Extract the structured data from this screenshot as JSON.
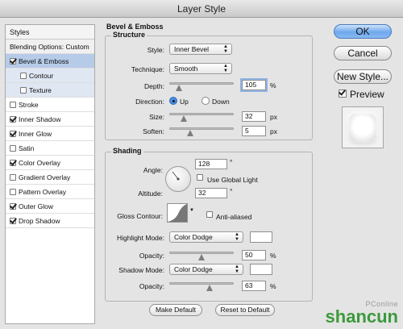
{
  "window": {
    "title": "Layer Style"
  },
  "styles_list": {
    "header": "Styles",
    "blending": "Blending Options: Custom",
    "items": [
      {
        "label": "Bevel & Emboss",
        "checked": true,
        "selected": true
      },
      {
        "label": "Contour",
        "checked": false,
        "sub": true
      },
      {
        "label": "Texture",
        "checked": false,
        "sub": true
      },
      {
        "label": "Stroke",
        "checked": false
      },
      {
        "label": "Inner Shadow",
        "checked": true
      },
      {
        "label": "Inner Glow",
        "checked": true
      },
      {
        "label": "Satin",
        "checked": false
      },
      {
        "label": "Color Overlay",
        "checked": true
      },
      {
        "label": "Gradient Overlay",
        "checked": false
      },
      {
        "label": "Pattern Overlay",
        "checked": false
      },
      {
        "label": "Outer Glow",
        "checked": true
      },
      {
        "label": "Drop Shadow",
        "checked": true
      }
    ]
  },
  "panel": {
    "title": "Bevel & Emboss",
    "structure": {
      "label": "Structure",
      "style_label": "Style:",
      "style_value": "Inner Bevel",
      "technique_label": "Technique:",
      "technique_value": "Smooth",
      "depth_label": "Depth:",
      "depth_value": "105",
      "depth_unit": "%",
      "depth_level": 0.105,
      "direction_label": "Direction:",
      "dir_up": "Up",
      "dir_down": "Down",
      "direction": "Up",
      "size_label": "Size:",
      "size_value": "32",
      "size_unit": "px",
      "soften_label": "Soften:",
      "soften_value": "5",
      "soften_unit": "px"
    },
    "shading": {
      "label": "Shading",
      "angle_label": "Angle:",
      "angle_value": "128",
      "degree": "°",
      "use_global_light": "Use Global Light",
      "use_global_light_checked": false,
      "altitude_label": "Altitude:",
      "altitude_value": "32",
      "gloss_label": "Gloss Contour:",
      "anti_aliased": "Anti-aliased",
      "anti_aliased_checked": false,
      "highlight_mode_label": "Highlight Mode:",
      "highlight_mode_value": "Color Dodge",
      "highlight_color": "#ffffff",
      "hl_opacity_label": "Opacity:",
      "hl_opacity_value": "50",
      "hl_opacity_unit": "%",
      "shadow_mode_label": "Shadow Mode:",
      "shadow_mode_value": "Color Dodge",
      "shadow_color": "#ffffff",
      "sh_opacity_label": "Opacity:",
      "sh_opacity_value": "63",
      "sh_opacity_unit": "%"
    },
    "make_default": "Make Default",
    "reset_default": "Reset to Default"
  },
  "buttons": {
    "ok": "OK",
    "cancel": "Cancel",
    "new_style": "New Style...",
    "preview": "Preview",
    "preview_checked": true
  },
  "watermark": {
    "site": "PConline",
    "brand": "shancun"
  }
}
